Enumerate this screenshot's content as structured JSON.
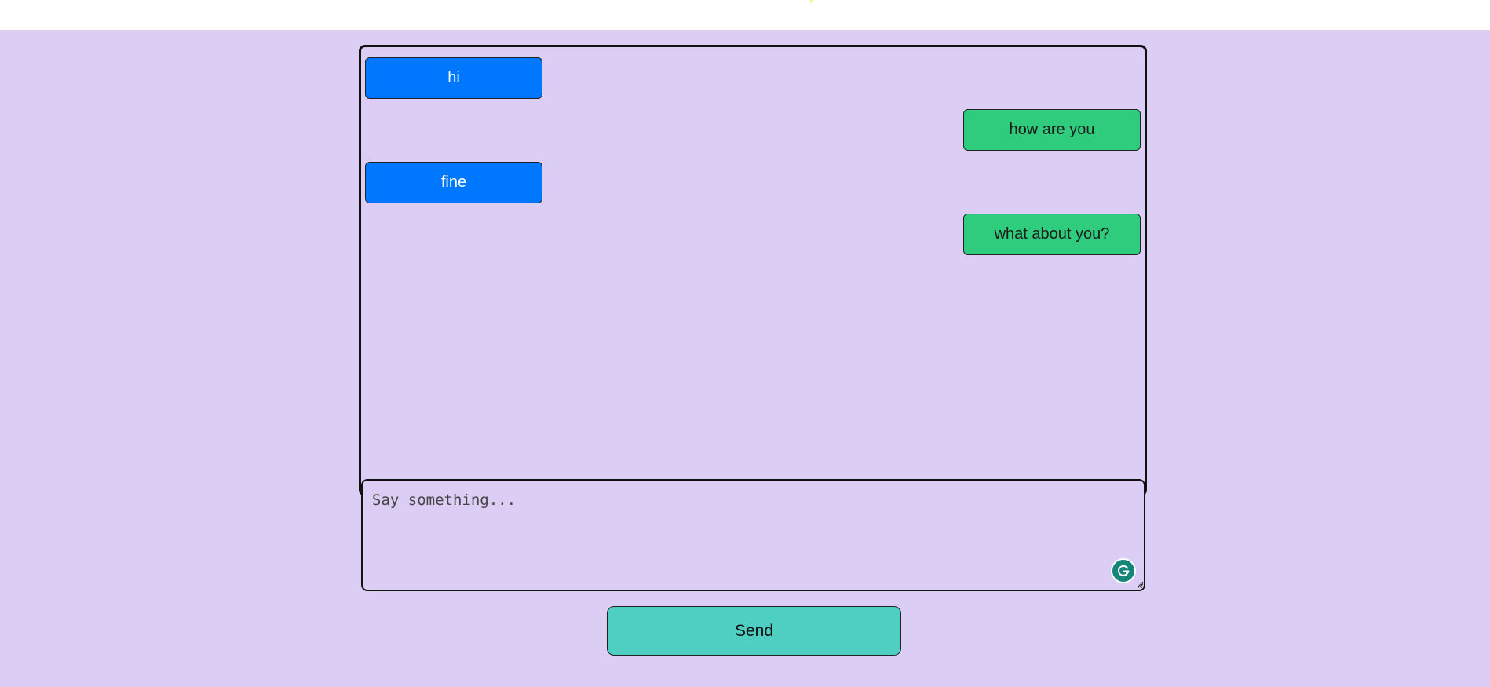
{
  "chat": {
    "messages": [
      {
        "text": "hi",
        "side": "left",
        "color": "#0077ff"
      },
      {
        "text": "how are you",
        "side": "right",
        "color": "#2fcc7e"
      },
      {
        "text": "fine",
        "side": "left",
        "color": "#0077ff"
      },
      {
        "text": "what about you?",
        "side": "right",
        "color": "#2fcc7e"
      }
    ]
  },
  "composer": {
    "placeholder": "Say something...",
    "value": ""
  },
  "send_button": {
    "label": "Send",
    "color": "#4ecfc1"
  },
  "grammar_badge": {
    "icon": "grammar-check-icon",
    "color": "#15857a"
  },
  "theme": {
    "background": "#dbcdf3",
    "header_background": "#ffffff"
  }
}
